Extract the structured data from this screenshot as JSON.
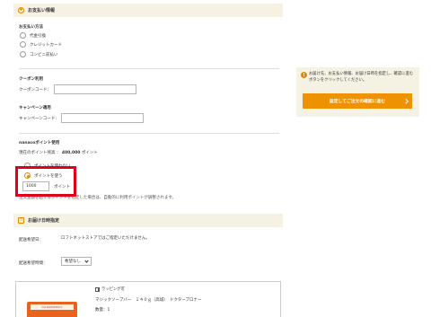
{
  "payment": {
    "section_title": "お支払い情報",
    "method_label": "お支払い方法",
    "methods": [
      "代金引換",
      "クレジットカード",
      "コンビニ前払い"
    ]
  },
  "coupon": {
    "heading": "クーポン利用",
    "field_label": "クーポンコード：",
    "value": ""
  },
  "campaign": {
    "heading": "キャンペーン適用",
    "field_label": "キャンペーンコード：",
    "value": ""
  },
  "nanaco": {
    "heading": "nanacoポイント使用",
    "balance_label": "現在のポイント残高 ：",
    "balance_value": "400,000",
    "balance_unit": "ポイント",
    "option_no_use": "ポイントを使わない",
    "option_use": "ポイントを使う",
    "points_value": "1000",
    "points_unit": "ポイント",
    "note": "注文金額を超えるポイントを指定した場合は、自動的に利用ポイントが調整されます。"
  },
  "delivery": {
    "section_title": "お届け日時指定",
    "date_label": "配送希望日：",
    "date_note": "ロフトネットストアではご指定いただけません。",
    "time_label": "配送希望時間：",
    "time_selected": "希望なし"
  },
  "product": {
    "wrapping_label": "ラッピング可",
    "name": "マジックソープバー　１４０ｇ（高城）　ドクターブロナー",
    "qty_label": "数量：",
    "qty_value": "1",
    "image_label": "DR.BRONNER'S"
  },
  "side": {
    "info_text": "お届け先、お支払い情報、お届け日時を指定し、確認に進むボタンをクリックしてください。",
    "confirm_label": "設定してご注文の確認に進む"
  },
  "colors": {
    "accent": "#ef9200",
    "highlight": "#e0001a",
    "section_bg": "#f5f2e3"
  }
}
